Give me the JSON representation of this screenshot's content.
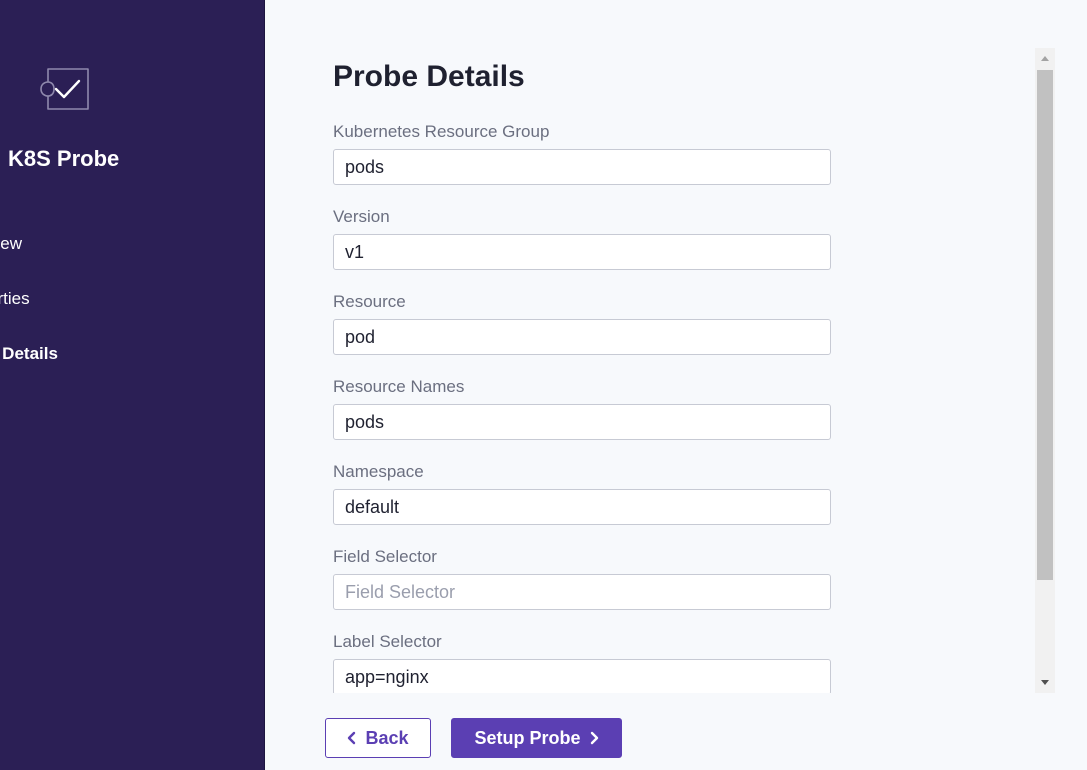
{
  "sidebar": {
    "logo_icon": "puzzle-check-icon",
    "title": "K8S Probe",
    "steps": [
      {
        "label": "view",
        "active": false
      },
      {
        "label": "erties",
        "active": false
      },
      {
        "label": "e Details",
        "active": true
      }
    ]
  },
  "main": {
    "heading": "Probe Details",
    "fields": [
      {
        "label": "Kubernetes Resource Group",
        "value": "pods",
        "placeholder": ""
      },
      {
        "label": "Version",
        "value": "v1",
        "placeholder": ""
      },
      {
        "label": "Resource",
        "value": "pod",
        "placeholder": ""
      },
      {
        "label": "Resource Names",
        "value": "pods",
        "placeholder": ""
      },
      {
        "label": "Namespace",
        "value": "default",
        "placeholder": ""
      },
      {
        "label": "Field Selector",
        "value": "",
        "placeholder": "Field Selector"
      },
      {
        "label": "Label Selector",
        "value": "app=nginx",
        "placeholder": ""
      }
    ]
  },
  "footer": {
    "back_label": "Back",
    "next_label": "Setup Probe"
  },
  "colors": {
    "sidebar_bg": "#2b1f55",
    "accent": "#5b3fb3",
    "page_bg": "#f7f9fc"
  }
}
